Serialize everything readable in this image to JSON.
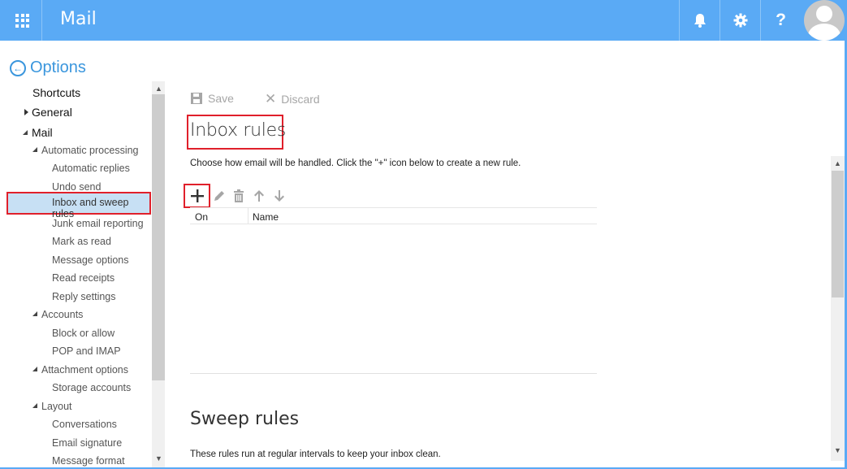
{
  "header": {
    "app_title": "Mail",
    "icons": [
      "app-launcher-icon",
      "bell-icon",
      "gear-icon",
      "help-icon",
      "avatar"
    ],
    "help_glyph": "?",
    "accent_color": "#5aaaf5"
  },
  "options": {
    "back_label": "Options"
  },
  "nav": {
    "items": [
      {
        "label": "Shortcuts",
        "level": 0
      },
      {
        "label": "General",
        "level": 0,
        "expanded": false
      },
      {
        "label": "Mail",
        "level": 0,
        "expanded": true
      },
      {
        "label": "Automatic processing",
        "level": 1,
        "expanded": true
      },
      {
        "label": "Automatic replies",
        "level": 2
      },
      {
        "label": "Undo send",
        "level": 2
      },
      {
        "label": "Inbox and sweep rules",
        "level": 2,
        "selected": true
      },
      {
        "label": "Junk email reporting",
        "level": 2
      },
      {
        "label": "Mark as read",
        "level": 2
      },
      {
        "label": "Message options",
        "level": 2
      },
      {
        "label": "Read receipts",
        "level": 2
      },
      {
        "label": "Reply settings",
        "level": 2
      },
      {
        "label": "Accounts",
        "level": 1,
        "expanded": true
      },
      {
        "label": "Block or allow",
        "level": 2
      },
      {
        "label": "POP and IMAP",
        "level": 2
      },
      {
        "label": "Attachment options",
        "level": 1,
        "expanded": true
      },
      {
        "label": "Storage accounts",
        "level": 2
      },
      {
        "label": "Layout",
        "level": 1,
        "expanded": true
      },
      {
        "label": "Conversations",
        "level": 2
      },
      {
        "label": "Email signature",
        "level": 2
      },
      {
        "label": "Message format",
        "level": 2
      }
    ]
  },
  "toolbar": {
    "save_label": "Save",
    "discard_label": "Discard"
  },
  "inbox_rules": {
    "title": "Inbox rules",
    "description": "Choose how email will be handled. Click the \"+\" icon below to create a new rule.",
    "tools": [
      "add-icon",
      "edit-icon",
      "delete-icon",
      "move-up-icon",
      "move-down-icon"
    ],
    "columns": [
      "On",
      "Name"
    ]
  },
  "sweep_rules": {
    "title": "Sweep rules",
    "description": "These rules run at regular intervals to keep your inbox clean."
  },
  "highlight_color": "#e0202b",
  "selection_color": "#c7e0f4"
}
